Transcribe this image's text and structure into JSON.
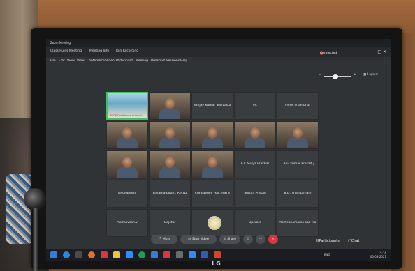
{
  "window": {
    "title": "Zoom Meeting",
    "tabs": [
      "Class Rules Meeting",
      "Meeting Info",
      "Join Recording"
    ],
    "status": "Connected",
    "menu": [
      "File",
      "Edit",
      "View",
      "View",
      "Conference Video",
      "Participant",
      "Meeting",
      "Breakout Sessions",
      "Help"
    ],
    "layout_label": "Layout"
  },
  "tiles": [
    {
      "name": "",
      "type": "banner",
      "caption": "ZGCP Conference Cultural ...",
      "active": true
    },
    {
      "name": "",
      "type": "video"
    },
    {
      "name": "Sanjay Kumar Shrivastav",
      "type": "name"
    },
    {
      "name": "PC",
      "type": "name"
    },
    {
      "name": "Vivek Shambhar",
      "type": "name"
    },
    {
      "name": "",
      "type": "video"
    },
    {
      "name": "",
      "type": "video"
    },
    {
      "name": "",
      "type": "video"
    },
    {
      "name": "",
      "type": "video"
    },
    {
      "name": "",
      "type": "video"
    },
    {
      "name": "",
      "type": "video"
    },
    {
      "name": "",
      "type": "video"
    },
    {
      "name": "",
      "type": "video"
    },
    {
      "name": "A C Surya Prakhar",
      "type": "name"
    },
    {
      "name": "Anil Kumar Prasad",
      "type": "name",
      "arrow": true
    },
    {
      "name": "RPCMEWAS",
      "type": "name"
    },
    {
      "name": "Pavamadaram, RIRTD",
      "type": "name"
    },
    {
      "name": "Confidence Hall, RSTB",
      "type": "name"
    },
    {
      "name": "Shisha Prasad",
      "type": "name"
    },
    {
      "name": "B.D. Thangamani",
      "type": "name"
    },
    {
      "name": "Madhavesh.v",
      "type": "name"
    },
    {
      "name": "Gajetar",
      "type": "name"
    },
    {
      "name": "",
      "type": "logo"
    },
    {
      "name": "Operate",
      "type": "name"
    },
    {
      "name": "Mathsonomaroli CLF Hostu",
      "type": "name"
    }
  ],
  "toolbar": {
    "mute": "Mute",
    "stop_video": "Stop video",
    "share": "Share",
    "participants": "Participants",
    "chat": "Chat"
  },
  "taskbar": {
    "lang": "ENG",
    "time": "15:16",
    "date": "06-08-2021"
  },
  "brand": "LG"
}
